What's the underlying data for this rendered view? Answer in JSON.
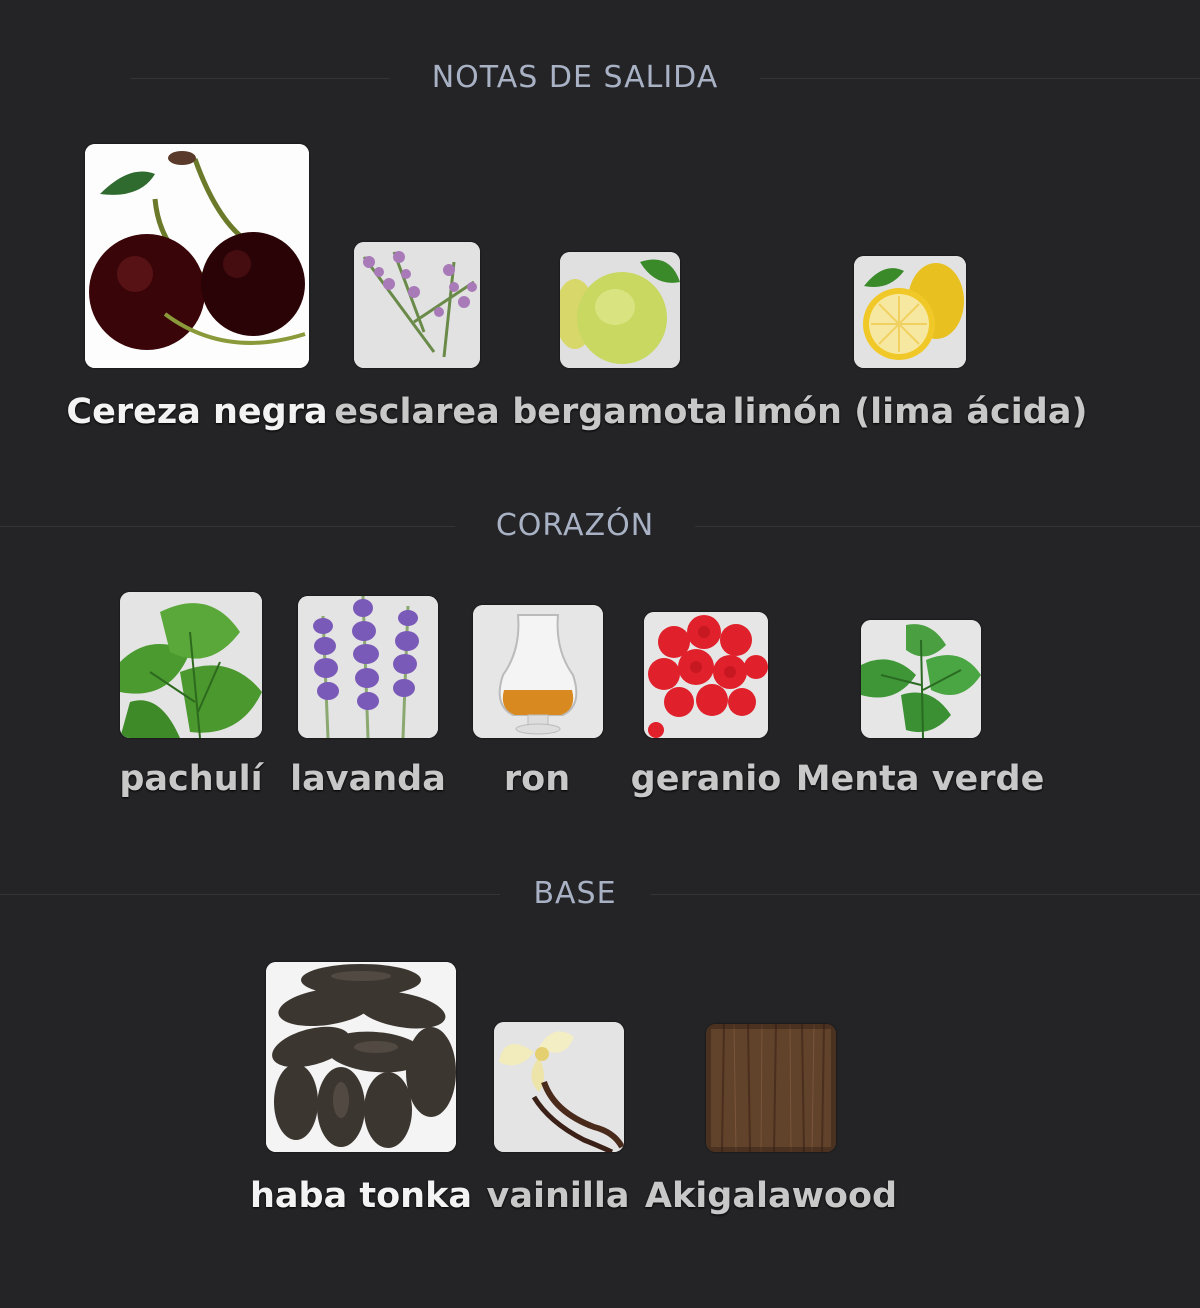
{
  "sections": [
    {
      "title": "NOTAS DE SALIDA",
      "notes": [
        {
          "label": "Cereza negra",
          "icon": "black-cherry-icon",
          "highlight": true
        },
        {
          "label": "esclarea",
          "icon": "clary-sage-icon",
          "highlight": false
        },
        {
          "label": "bergamota",
          "icon": "bergamot-icon",
          "highlight": false
        },
        {
          "label": "limón (lima ácida)",
          "icon": "lemon-icon",
          "highlight": false
        }
      ]
    },
    {
      "title": "CORAZÓN",
      "notes": [
        {
          "label": "pachulí",
          "icon": "patchouli-leaf-icon",
          "highlight": false
        },
        {
          "label": "lavanda",
          "icon": "lavender-icon",
          "highlight": false
        },
        {
          "label": "ron",
          "icon": "rum-glass-icon",
          "highlight": false
        },
        {
          "label": "geranio",
          "icon": "geranium-icon",
          "highlight": false
        },
        {
          "label": "Menta verde",
          "icon": "spearmint-icon",
          "highlight": false
        }
      ]
    },
    {
      "title": "BASE",
      "notes": [
        {
          "label": "haba tonka",
          "icon": "tonka-bean-icon",
          "highlight": true
        },
        {
          "label": "vainilla",
          "icon": "vanilla-icon",
          "highlight": false
        },
        {
          "label": "Akigalawood",
          "icon": "wood-icon",
          "highlight": false
        }
      ]
    }
  ]
}
